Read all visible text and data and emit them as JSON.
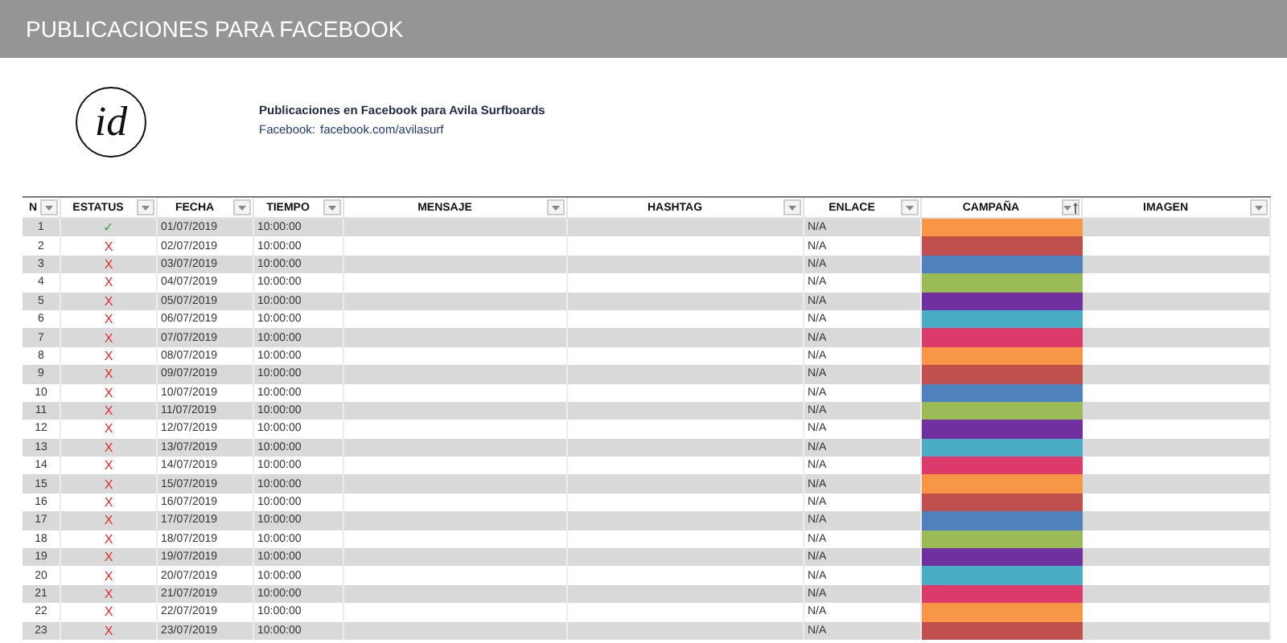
{
  "title": "PUBLICACIONES PARA FACEBOOK",
  "logo": {
    "text": "id"
  },
  "info": {
    "heading": "Publicaciones en Facebook para Avila Surfboards",
    "link_label": "Facebook:",
    "link": "facebook.com/avilasurf"
  },
  "columns": [
    {
      "label": "N",
      "sorted": false
    },
    {
      "label": "ESTATUS",
      "sorted": false
    },
    {
      "label": "FECHA",
      "sorted": false
    },
    {
      "label": "TIEMPO",
      "sorted": false
    },
    {
      "label": "MENSAJE",
      "sorted": false
    },
    {
      "label": "HASHTAG",
      "sorted": false
    },
    {
      "label": "ENLACE",
      "sorted": false
    },
    {
      "label": "CAMPAÑA",
      "sorted": true
    },
    {
      "label": "IMAGEN",
      "sorted": false
    }
  ],
  "rows": [
    {
      "n": "1",
      "status": {
        "symbol": "✓",
        "done": true
      },
      "fecha": "01/07/2019",
      "tiempo": "10:00:00",
      "enlace": "N/A",
      "color": "#f79646"
    },
    {
      "n": "2",
      "status": {
        "symbol": "X",
        "done": false
      },
      "fecha": "02/07/2019",
      "tiempo": "10:00:00",
      "enlace": "N/A",
      "color": "#c0504d"
    },
    {
      "n": "3",
      "status": {
        "symbol": "X",
        "done": false
      },
      "fecha": "03/07/2019",
      "tiempo": "10:00:00",
      "enlace": "N/A",
      "color": "#4f81bd"
    },
    {
      "n": "4",
      "status": {
        "symbol": "X",
        "done": false
      },
      "fecha": "04/07/2019",
      "tiempo": "10:00:00",
      "enlace": "N/A",
      "color": "#9bbb59"
    },
    {
      "n": "5",
      "status": {
        "symbol": "X",
        "done": false
      },
      "fecha": "05/07/2019",
      "tiempo": "10:00:00",
      "enlace": "N/A",
      "color": "#7030a0"
    },
    {
      "n": "6",
      "status": {
        "symbol": "X",
        "done": false
      },
      "fecha": "06/07/2019",
      "tiempo": "10:00:00",
      "enlace": "N/A",
      "color": "#4bacc6"
    },
    {
      "n": "7",
      "status": {
        "symbol": "X",
        "done": false
      },
      "fecha": "07/07/2019",
      "tiempo": "10:00:00",
      "enlace": "N/A",
      "color": "#dc3a6a"
    },
    {
      "n": "8",
      "status": {
        "symbol": "X",
        "done": false
      },
      "fecha": "08/07/2019",
      "tiempo": "10:00:00",
      "enlace": "N/A",
      "color": "#f79646"
    },
    {
      "n": "9",
      "status": {
        "symbol": "X",
        "done": false
      },
      "fecha": "09/07/2019",
      "tiempo": "10:00:00",
      "enlace": "N/A",
      "color": "#c0504d"
    },
    {
      "n": "10",
      "status": {
        "symbol": "X",
        "done": false
      },
      "fecha": "10/07/2019",
      "tiempo": "10:00:00",
      "enlace": "N/A",
      "color": "#4f81bd"
    },
    {
      "n": "11",
      "status": {
        "symbol": "X",
        "done": false
      },
      "fecha": "11/07/2019",
      "tiempo": "10:00:00",
      "enlace": "N/A",
      "color": "#9bbb59"
    },
    {
      "n": "12",
      "status": {
        "symbol": "X",
        "done": false
      },
      "fecha": "12/07/2019",
      "tiempo": "10:00:00",
      "enlace": "N/A",
      "color": "#7030a0"
    },
    {
      "n": "13",
      "status": {
        "symbol": "X",
        "done": false
      },
      "fecha": "13/07/2019",
      "tiempo": "10:00:00",
      "enlace": "N/A",
      "color": "#4bacc6"
    },
    {
      "n": "14",
      "status": {
        "symbol": "X",
        "done": false
      },
      "fecha": "14/07/2019",
      "tiempo": "10:00:00",
      "enlace": "N/A",
      "color": "#dc3a6a"
    },
    {
      "n": "15",
      "status": {
        "symbol": "X",
        "done": false
      },
      "fecha": "15/07/2019",
      "tiempo": "10:00:00",
      "enlace": "N/A",
      "color": "#f79646"
    },
    {
      "n": "16",
      "status": {
        "symbol": "X",
        "done": false
      },
      "fecha": "16/07/2019",
      "tiempo": "10:00:00",
      "enlace": "N/A",
      "color": "#c0504d"
    },
    {
      "n": "17",
      "status": {
        "symbol": "X",
        "done": false
      },
      "fecha": "17/07/2019",
      "tiempo": "10:00:00",
      "enlace": "N/A",
      "color": "#4f81bd"
    },
    {
      "n": "18",
      "status": {
        "symbol": "X",
        "done": false
      },
      "fecha": "18/07/2019",
      "tiempo": "10:00:00",
      "enlace": "N/A",
      "color": "#9bbb59"
    },
    {
      "n": "19",
      "status": {
        "symbol": "X",
        "done": false
      },
      "fecha": "19/07/2019",
      "tiempo": "10:00:00",
      "enlace": "N/A",
      "color": "#7030a0"
    },
    {
      "n": "20",
      "status": {
        "symbol": "X",
        "done": false
      },
      "fecha": "20/07/2019",
      "tiempo": "10:00:00",
      "enlace": "N/A",
      "color": "#4bacc6"
    },
    {
      "n": "21",
      "status": {
        "symbol": "X",
        "done": false
      },
      "fecha": "21/07/2019",
      "tiempo": "10:00:00",
      "enlace": "N/A",
      "color": "#dc3a6a"
    },
    {
      "n": "22",
      "status": {
        "symbol": "X",
        "done": false
      },
      "fecha": "22/07/2019",
      "tiempo": "10:00:00",
      "enlace": "N/A",
      "color": "#f79646"
    },
    {
      "n": "23",
      "status": {
        "symbol": "X",
        "done": false
      },
      "fecha": "23/07/2019",
      "tiempo": "10:00:00",
      "enlace": "N/A",
      "color": "#c0504d"
    }
  ]
}
